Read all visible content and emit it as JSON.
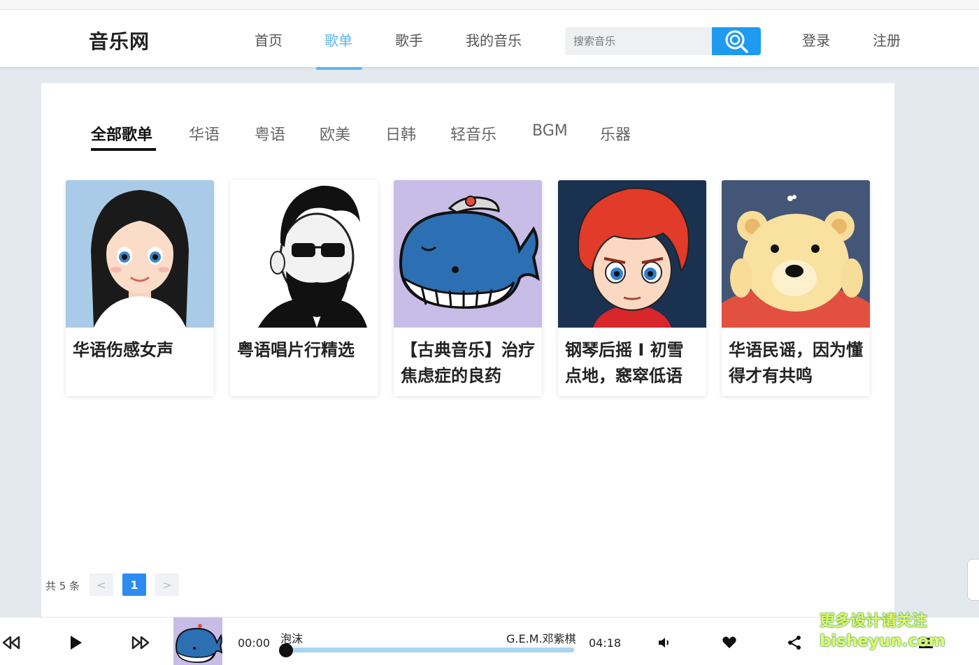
{
  "header": {
    "logo": "音乐网",
    "nav": [
      "首页",
      "歌单",
      "歌手",
      "我的音乐"
    ],
    "active_nav": "歌单",
    "search_placeholder": "搜索音乐",
    "login": "登录",
    "register": "注册"
  },
  "tabs": [
    "全部歌单",
    "华语",
    "粤语",
    "欧美",
    "日韩",
    "轻音乐",
    "BGM",
    "乐器"
  ],
  "active_tab": "全部歌单",
  "playlists": [
    {
      "title": "华语伤感女声",
      "cover_icon": "cartoon-girl-cover"
    },
    {
      "title": "粤语唱片行精选",
      "cover_icon": "bearded-man-cover"
    },
    {
      "title": "【古典音乐】治疗焦虑症的良药",
      "cover_icon": "blue-whale-cover"
    },
    {
      "title": "钢琴后摇 I 初雪点地，窸窣低语",
      "cover_icon": "red-hair-boy-cover"
    },
    {
      "title": "华语民谣，因为懂得才有共鸣",
      "cover_icon": "teddy-bear-cover"
    }
  ],
  "pagination": {
    "total": "共 5 条",
    "current": "1",
    "prev": "<",
    "next": ">"
  },
  "player": {
    "current_time": "00:00",
    "total_time": "04:18",
    "song": "泡沫",
    "artist": "G.E.M.邓紫棋",
    "progress": 0
  },
  "watermark": {
    "line1": "更多设计请关注",
    "line2": "bisheyun.com"
  },
  "colors": {
    "accent": "#5cb6ee",
    "search_button": "#1e9bf0",
    "pager_active": "#2d8cf0",
    "progress_track": "#a8d6f4"
  }
}
